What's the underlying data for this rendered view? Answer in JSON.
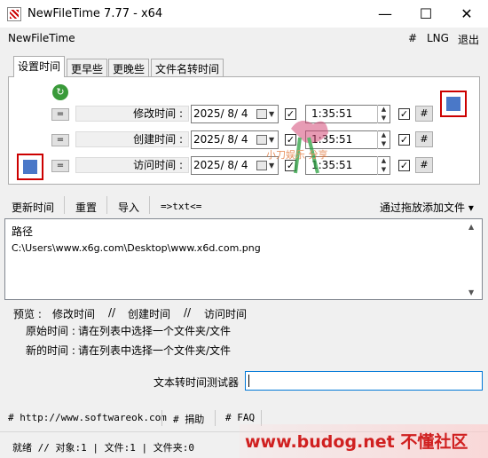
{
  "window": {
    "title": "NewFileTime 7.77 - x64",
    "minimize": "—",
    "maximize": "☐",
    "close": "✕"
  },
  "menu": {
    "app_name": "NewFileTime",
    "hash": "#",
    "lng": "LNG",
    "exit": "退出"
  },
  "tabs": [
    "设置时间",
    "更早些",
    "更晚些",
    "文件名转时间"
  ],
  "time_rows": [
    {
      "button": "=",
      "label": "修改时间 :",
      "date": "2025/ 8/ 4",
      "time": "1:35:51",
      "hash": "#"
    },
    {
      "button": "=",
      "label": "创建时间 :",
      "date": "2025/ 8/ 4",
      "time": "1:35:51",
      "hash": "#"
    },
    {
      "button": "=",
      "label": "访问时间 :",
      "date": "2025/ 8/ 4",
      "time": "1:35:51",
      "hash": "#"
    }
  ],
  "toolbar": {
    "update": "更新时间",
    "reset": "重置",
    "import": "导入",
    "txt": "=>txt<=",
    "add_by_drag": "通过拖放添加文件 ▾"
  },
  "list": {
    "header": "路径",
    "items": [
      "C:\\Users\\www.x6g.com\\Desktop\\www.x6d.com.png"
    ]
  },
  "preview": {
    "label": "预览 :",
    "modify": "修改时间",
    "sep1": "//",
    "create": "创建时间",
    "sep2": "//",
    "access": "访问时间",
    "original_label": "原始时间 :",
    "original_value": "请在列表中选择一个文件夹/文件",
    "new_label": "新的时间 :",
    "new_value": "请在列表中选择一个文件夹/文件"
  },
  "tester": {
    "label": "文本转时间测试器",
    "value": ""
  },
  "links": {
    "site": "# http://www.softwareok.com",
    "donate": "# 捐助",
    "faq": "# FAQ"
  },
  "status": {
    "text": "就绪 // 对象:1  | 文件:1  | 文件夹:0"
  },
  "watermark": {
    "text": "www.budog.net 不懂社区",
    "stamp": "小刀娱乐 分享"
  },
  "colors": {
    "accent": "#0078d7",
    "watermark_red": "#d02020"
  }
}
